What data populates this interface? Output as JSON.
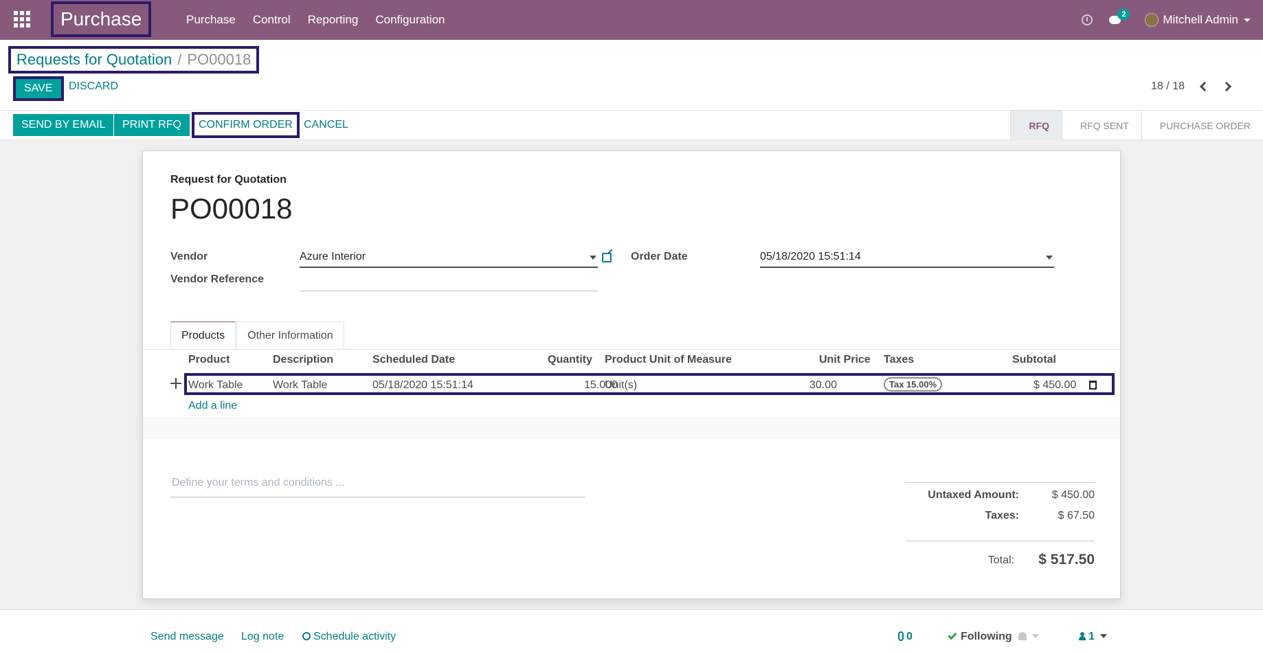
{
  "navbar": {
    "app_name": "Purchase",
    "menus": [
      "Purchase",
      "Control",
      "Reporting",
      "Configuration"
    ],
    "message_count": "2",
    "user_name": "Mitchell Admin"
  },
  "breadcrumb": {
    "parent": "Requests for Quotation",
    "separator": "/",
    "current": "PO00018"
  },
  "actions": {
    "save": "SAVE",
    "discard": "DISCARD"
  },
  "pager": {
    "value": "18 / 18"
  },
  "statusbar": {
    "send_by_email": "SEND BY EMAIL",
    "print_rfq": "PRINT RFQ",
    "confirm_order": "CONFIRM ORDER",
    "cancel": "CANCEL",
    "stages": [
      "RFQ",
      "RFQ SENT",
      "PURCHASE ORDER"
    ],
    "active_stage": "RFQ"
  },
  "form": {
    "doc_type": "Request for Quotation",
    "name": "PO00018",
    "vendor_label": "Vendor",
    "vendor_value": "Azure Interior",
    "vendor_ref_label": "Vendor Reference",
    "vendor_ref_value": "",
    "order_date_label": "Order Date",
    "order_date_value": "05/18/2020 15:51:14"
  },
  "tabs": [
    "Products",
    "Other Information"
  ],
  "lines": {
    "headers": {
      "product": "Product",
      "description": "Description",
      "scheduled_date": "Scheduled Date",
      "quantity": "Quantity",
      "uom": "Product Unit of Measure",
      "unit_price": "Unit Price",
      "taxes": "Taxes",
      "subtotal": "Subtotal"
    },
    "rows": [
      {
        "product": "Work Table",
        "description": "Work Table",
        "scheduled_date": "05/18/2020 15:51:14",
        "quantity": "15.000",
        "uom": "Unit(s)",
        "unit_price": "30.00",
        "taxes": "Tax 15.00%",
        "subtotal": "$ 450.00"
      }
    ],
    "add_line": "Add a line"
  },
  "terms": {
    "placeholder": "Define your terms and conditions ..."
  },
  "totals": {
    "untaxed_label": "Untaxed Amount:",
    "untaxed_value": "$ 450.00",
    "taxes_label": "Taxes:",
    "taxes_value": "$ 67.50",
    "total_label": "Total:",
    "total_value": "$ 517.50"
  },
  "chatter": {
    "send_message": "Send message",
    "log_note": "Log note",
    "schedule_activity": "Schedule activity",
    "attachments": "0",
    "following": "Following",
    "followers": "1"
  },
  "colors": {
    "navbar": "#875a7b",
    "primary": "#00a09d",
    "link": "#017e84",
    "highlight_border": "#2d1b69"
  }
}
